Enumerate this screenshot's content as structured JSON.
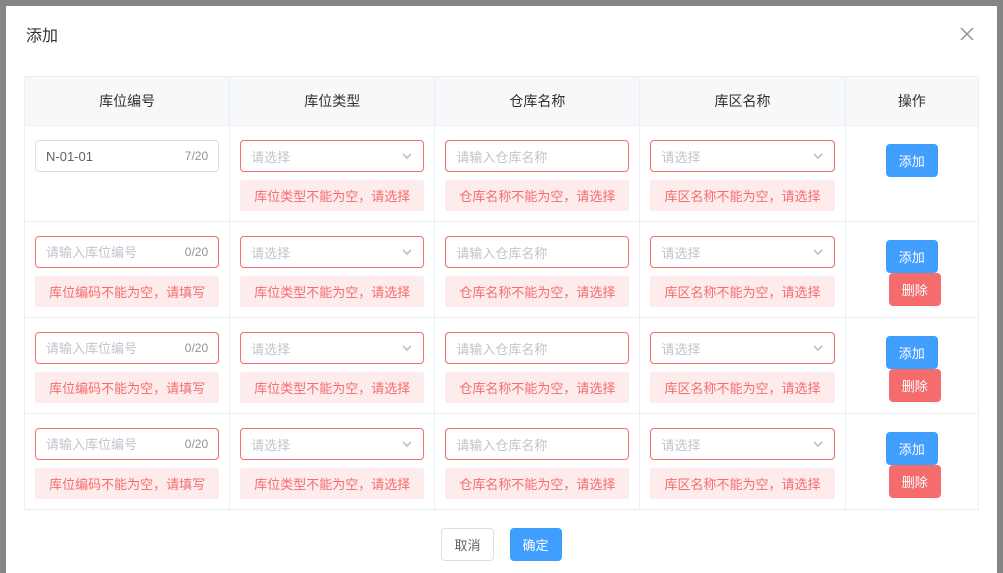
{
  "modal": {
    "title": "添加"
  },
  "headers": {
    "code": "库位编号",
    "type": "库位类型",
    "wh": "仓库名称",
    "area": "库区名称",
    "action": "操作"
  },
  "placeholders": {
    "code": "请输入库位编号",
    "select": "请选择",
    "wh": "请输入仓库名称"
  },
  "errors": {
    "code": "库位编码不能为空，请填写",
    "type": "库位类型不能为空，请选择",
    "wh": "仓库名称不能为空，请选择",
    "area": "库区名称不能为空，请选择"
  },
  "buttons": {
    "add": "添加",
    "delete": "删除",
    "cancel": "取消",
    "ok": "确定"
  },
  "rows": {
    "0": {
      "code_value": "N-01-01",
      "code_counter": "7/20",
      "has_delete": false,
      "has_code_error": false,
      "code_normal": true
    },
    "1": {
      "code_value": "",
      "code_counter": "0/20",
      "has_delete": true,
      "has_code_error": true,
      "code_normal": false
    },
    "2": {
      "code_value": "",
      "code_counter": "0/20",
      "has_delete": true,
      "has_code_error": true,
      "code_normal": false
    },
    "3": {
      "code_value": "",
      "code_counter": "0/20",
      "has_delete": true,
      "has_code_error": true,
      "code_normal": false
    }
  }
}
